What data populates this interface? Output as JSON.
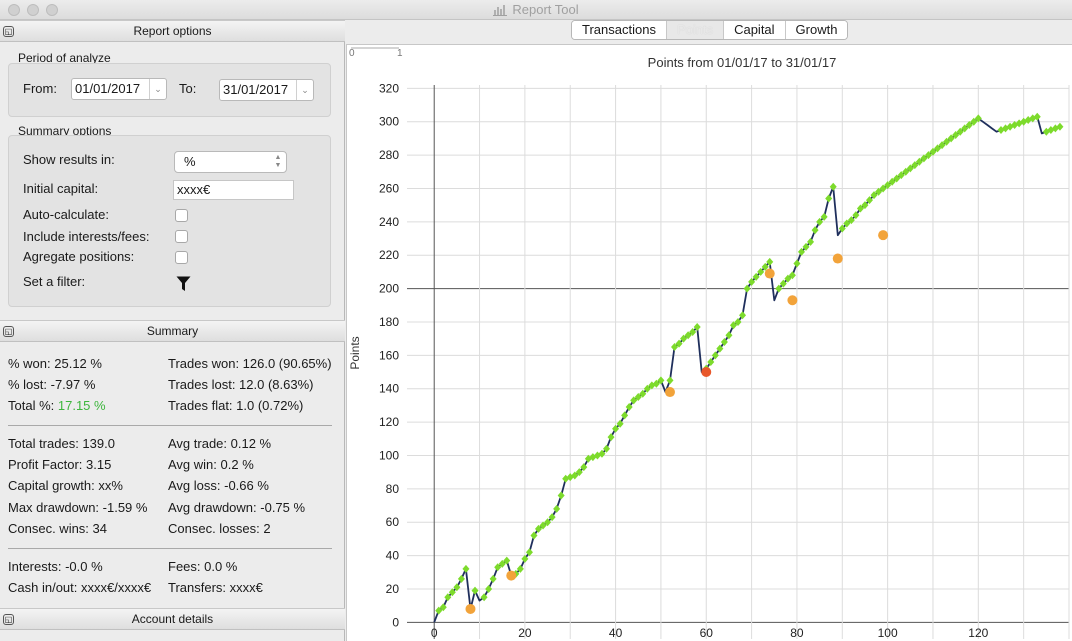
{
  "window": {
    "title": "Report Tool"
  },
  "report_options": {
    "header": "Report options",
    "period": {
      "label": "Period of analyze",
      "from_label": "From:",
      "from_value": "01/01/2017",
      "to_label": "To:",
      "to_value": "31/01/2017"
    },
    "summary_options": {
      "label": "Summary options",
      "show_results_label": "Show results in:",
      "show_results_value": "%",
      "initial_capital_label": "Initial capital:",
      "initial_capital_value": "xxxx€",
      "auto_calculate_label": "Auto-calculate:",
      "auto_calculate_checked": false,
      "include_interests_label": "Include interests/fees:",
      "include_interests_checked": false,
      "agregate_label": "Agregate positions:",
      "agregate_checked": false,
      "filter_label": "Set a filter:"
    }
  },
  "summary": {
    "header": "Summary",
    "won_pct": "% won: 25.12 %",
    "lost_pct": "% lost: -7.97 %",
    "total_pct_label": "Total %:",
    "total_pct_value": "17.15 %",
    "trades_won": "Trades won: 126.0 (90.65%)",
    "trades_lost": "Trades lost: 12.0 (8.63%)",
    "trades_flat": "Trades flat: 1.0 (0.72%)",
    "total_trades": "Total trades: 139.0",
    "profit_factor": "Profit Factor: 3.15",
    "capital_growth": "Capital growth: xx%",
    "max_drawdown": "Max drawdown: -1.59 %",
    "consec_wins": "Consec. wins: 34",
    "avg_trade": "Avg trade: 0.12 %",
    "avg_win": "Avg win: 0.2 %",
    "avg_loss": "Avg loss: -0.66 %",
    "avg_drawdown": "Avg drawdown: -0.75 %",
    "consec_losses": "Consec. losses: 2",
    "interests": "Interests: -0.0 %",
    "fees": "Fees: 0.0 %",
    "cash_inout": "Cash in/out: xxxx€/xxxx€",
    "transfers": "Transfers: xxxx€"
  },
  "account_details": {
    "header": "Account details"
  },
  "tabs": [
    {
      "label": "Transactions",
      "active": false
    },
    {
      "label": "Points",
      "active": true
    },
    {
      "label": "Capital",
      "active": false
    },
    {
      "label": "Growth",
      "active": false
    }
  ],
  "colors": {
    "line": "#1f2f5c",
    "win_marker": "#7ddb2c",
    "loss_marker": "#f2a33a",
    "max_loss_marker": "#e8572a",
    "positive_text": "#3db63d"
  },
  "chart_data": {
    "type": "line",
    "title": "Points from 01/01/17 to 31/01/17",
    "ylabel": "Points",
    "xlabel": "",
    "corner_ticks": [
      "0",
      "1"
    ],
    "xlim": [
      -6,
      140
    ],
    "ylim": [
      -10,
      322
    ],
    "xticks": [
      0,
      20,
      40,
      60,
      80,
      100,
      120
    ],
    "yticks": [
      0,
      20,
      40,
      60,
      80,
      100,
      120,
      140,
      160,
      180,
      200,
      220,
      240,
      260,
      280,
      300,
      320
    ],
    "grid": true,
    "series": [
      {
        "x": [
          0,
          1,
          2,
          3,
          4,
          5,
          6,
          7,
          8,
          9,
          10,
          11,
          12,
          13,
          14,
          15,
          16,
          17,
          18,
          19,
          20,
          21,
          22,
          23,
          24,
          25,
          26,
          27,
          28,
          29,
          30,
          31,
          32,
          33,
          34,
          35,
          36,
          37,
          38,
          39,
          40,
          41,
          42,
          43,
          44,
          45,
          46,
          47,
          48,
          49,
          50,
          51,
          52,
          53,
          54,
          55,
          56,
          57,
          58,
          59,
          60,
          61,
          62,
          63,
          64,
          65,
          66,
          67,
          68,
          69,
          70,
          71,
          72,
          73,
          74,
          75,
          76,
          77,
          78,
          79,
          80,
          81,
          82,
          83,
          84,
          85,
          86,
          87,
          88,
          89,
          90,
          91,
          92,
          93,
          94,
          95,
          96,
          97,
          98,
          99,
          100,
          101,
          102,
          103,
          104,
          105,
          106,
          107,
          108,
          109,
          110,
          111,
          112,
          113,
          114,
          115,
          116,
          117,
          118,
          119,
          120,
          121,
          122,
          123,
          124,
          125,
          126,
          127,
          128,
          129,
          130,
          131,
          132,
          133,
          134,
          135,
          136,
          137,
          138
        ],
        "y": [
          0,
          7,
          9,
          15,
          18,
          21,
          26,
          32,
          8,
          19,
          13,
          15,
          20,
          26,
          33,
          35,
          37,
          28,
          29,
          32,
          38,
          42,
          52,
          56,
          58,
          60,
          63,
          68,
          76,
          86,
          87,
          88,
          90,
          93,
          98,
          99,
          100,
          101,
          104,
          111,
          116,
          119,
          124,
          129,
          133,
          135,
          137,
          140,
          142,
          143,
          145,
          138,
          145,
          165,
          167,
          170,
          172,
          174,
          177,
          150,
          152,
          156,
          160,
          164,
          168,
          172,
          178,
          180,
          184,
          200,
          204,
          207,
          210,
          213,
          216,
          193,
          200,
          203,
          206,
          208,
          215,
          222,
          225,
          228,
          235,
          240,
          243,
          254,
          261,
          232,
          236,
          239,
          241,
          244,
          248,
          250,
          253,
          256,
          258,
          260,
          262,
          264,
          266,
          268,
          270,
          272,
          274,
          276,
          278,
          280,
          282,
          284,
          286,
          288,
          290,
          292,
          294,
          296,
          298,
          300,
          302,
          300,
          298,
          296,
          294,
          295,
          296,
          297,
          298,
          299,
          300,
          301,
          302,
          303,
          293,
          294,
          295,
          296,
          297
        ],
        "markers": [
          {
            "x": 8,
            "y": 8,
            "kind": "loss"
          },
          {
            "x": 17,
            "y": 28,
            "kind": "loss"
          },
          {
            "x": 52,
            "y": 138,
            "kind": "loss"
          },
          {
            "x": 60,
            "y": 150,
            "kind": "max_loss"
          },
          {
            "x": 74,
            "y": 209,
            "kind": "loss"
          },
          {
            "x": 79,
            "y": 193,
            "kind": "loss"
          },
          {
            "x": 89,
            "y": 218,
            "kind": "loss"
          },
          {
            "x": 99,
            "y": 232,
            "kind": "loss"
          }
        ]
      }
    ]
  }
}
